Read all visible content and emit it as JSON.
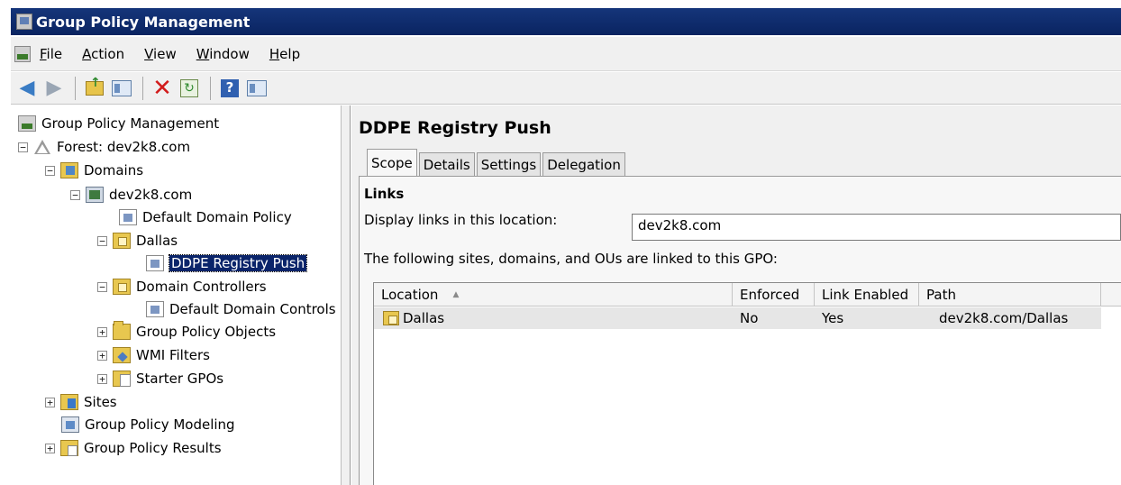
{
  "window": {
    "title": "Group Policy Management"
  },
  "menu": {
    "items": [
      "File",
      "Action",
      "View",
      "Window",
      "Help"
    ]
  },
  "toolbar": {
    "icons": [
      "back-icon",
      "forward-icon",
      "up-folder-icon",
      "show-hide-tree-icon",
      "delete-icon",
      "refresh-icon",
      "help-icon",
      "action-pane-icon"
    ]
  },
  "tree": {
    "root": "Group Policy Management",
    "forest": "Forest: dev2k8.com",
    "domains": "Domains",
    "domain": "dev2k8.com",
    "default_domain_policy": "Default Domain Policy",
    "dallas": "Dallas",
    "ddpe": "DDPE Registry Push",
    "domain_controllers": "Domain Controllers",
    "default_domain_controllers": "Default Domain Controls",
    "gpo_objects": "Group Policy Objects",
    "wmi_filters": "WMI Filters",
    "starter_gpos": "Starter GPOs",
    "sites": "Sites",
    "modeling": "Group Policy Modeling",
    "results": "Group Policy Results"
  },
  "details": {
    "title": "DDPE Registry Push",
    "tabs": [
      "Scope",
      "Details",
      "Settings",
      "Delegation"
    ],
    "active_tab": "Scope",
    "links_heading": "Links",
    "display_label": "Display links in this location:",
    "display_value": "dev2k8.com",
    "linked_label": "The following sites, domains, and OUs are linked to this GPO:",
    "columns": [
      "Location",
      "Enforced",
      "Link Enabled",
      "Path"
    ],
    "rows": [
      {
        "location": "Dallas",
        "enforced": "No",
        "link_enabled": "Yes",
        "path": "dev2k8.com/Dallas"
      }
    ]
  },
  "colors": {
    "titlebar": "#0a2461",
    "selection": "#0a246a",
    "background": "#f0f0f0"
  }
}
